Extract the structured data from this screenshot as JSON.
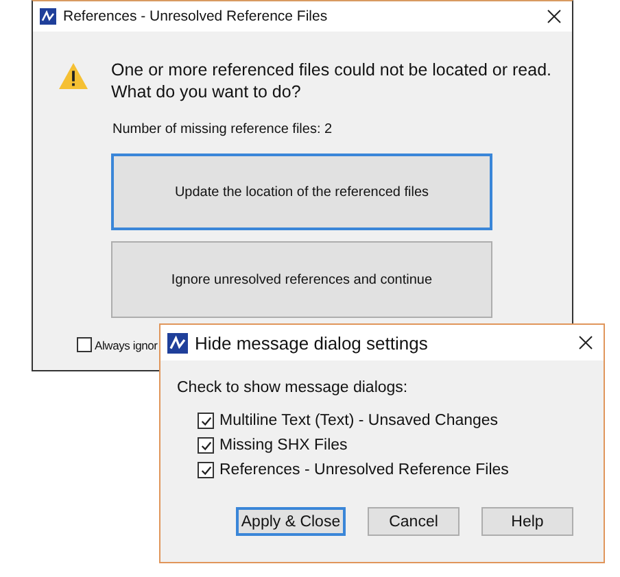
{
  "back_window": {
    "title": "References - Unresolved Reference Files",
    "message": [
      "One or more referenced files could not be located or read.",
      "What do you want to do?"
    ],
    "count_label": "Number of missing reference files: 2",
    "options": [
      {
        "label": "Update the location of the referenced files",
        "selected": true
      },
      {
        "label": "Ignore unresolved references and continue",
        "selected": false
      }
    ],
    "always_ignore": {
      "label": "Always ignor",
      "checked": false
    }
  },
  "front_window": {
    "title": "Hide message dialog settings",
    "heading": "Check to show message dialogs:",
    "items": [
      {
        "label": "Multiline Text (Text) - Unsaved Changes",
        "checked": true
      },
      {
        "label": "Missing SHX Files",
        "checked": true
      },
      {
        "label": "References - Unresolved Reference Files",
        "checked": true
      }
    ],
    "buttons": [
      {
        "label": "Apply & Close",
        "selected": true
      },
      {
        "label": "Cancel",
        "selected": false
      },
      {
        "label": "Help",
        "selected": false
      }
    ]
  }
}
